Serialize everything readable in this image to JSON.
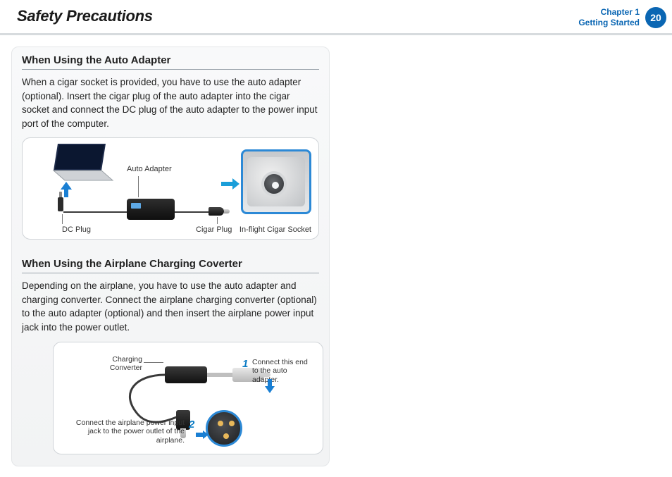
{
  "header": {
    "title": "Safety Precautions",
    "chapter_line1": "Chapter 1",
    "chapter_line2": "Getting Started",
    "page_number": "20"
  },
  "section1": {
    "heading": "When Using the Auto Adapter",
    "body": "When a cigar socket is provided, you have to use the auto adapter (optional). Insert the cigar plug of the auto adapter into the cigar socket and connect the DC plug of the auto adapter to the power input port of the computer.",
    "labels": {
      "auto_adapter": "Auto Adapter",
      "dc_plug": "DC Plug",
      "cigar_plug": "Cigar Plug",
      "inflight_socket": "In-flight Cigar Socket"
    }
  },
  "section2": {
    "heading": "When Using the Airplane Charging Coverter",
    "body": "Depending on the airplane, you have to use the auto adapter and charging converter. Connect the airplane charging converter (optional) to the auto adapter (optional) and then insert the airplane power input jack into the power outlet.",
    "labels": {
      "charging_converter": "Charging Converter",
      "step1_num": "1",
      "step1_text": "Connect this end to the auto adapter.",
      "step2_num": "2",
      "step2_text": "Connect the airplane power input jack to the power outlet of the airplane."
    }
  }
}
